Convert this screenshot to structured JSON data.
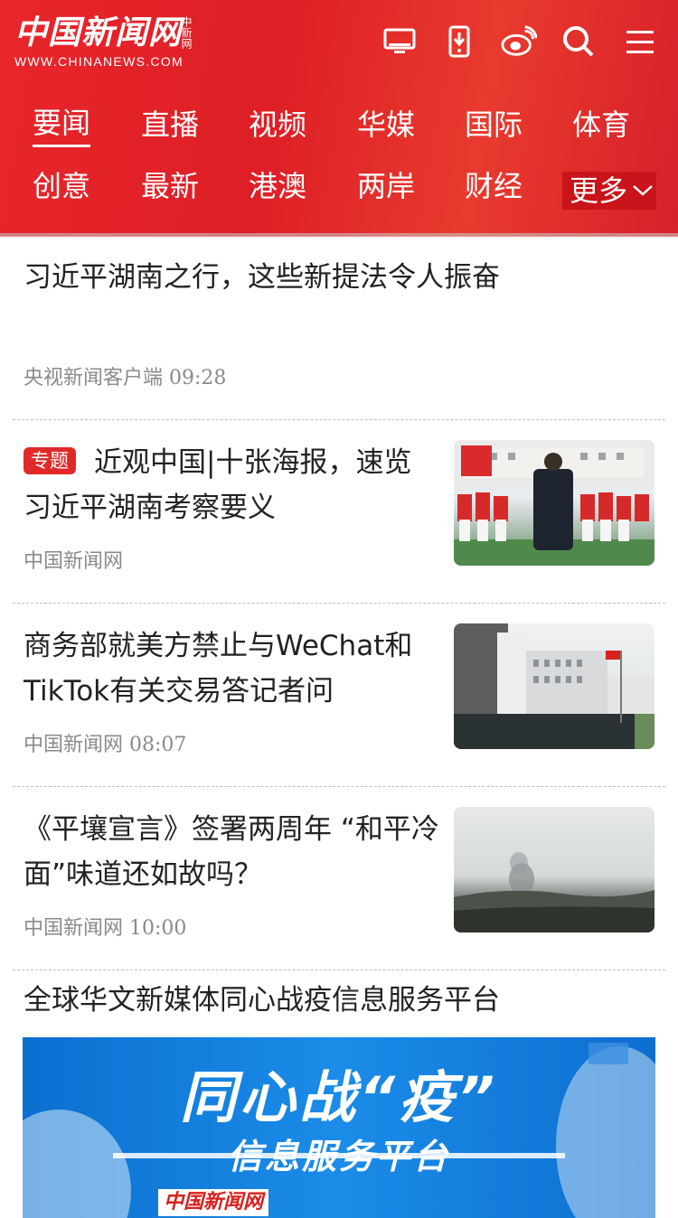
{
  "header": {
    "logo_cn": "中国新闻网",
    "logo_small": "中新网",
    "logo_en": "WWW.CHINANEWS.COM",
    "icons": [
      "tv-icon",
      "mobile-download-icon",
      "weibo-icon",
      "search-icon",
      "menu-icon"
    ]
  },
  "nav": {
    "row1": [
      "要闻",
      "直播",
      "视频",
      "华媒",
      "国际",
      "体育"
    ],
    "row2": [
      "创意",
      "最新",
      "港澳",
      "两岸",
      "财经"
    ],
    "more": "更多",
    "active": "要闻"
  },
  "articles": [
    {
      "title": "习近平湖南之行，这些新提法令人振奋",
      "source": "央视新闻客户端",
      "time": "09:28"
    },
    {
      "tag": "专题",
      "title": "近观中国|十张海报，速览习近平湖南考察要义",
      "source": "中国新闻网",
      "time": ""
    },
    {
      "title": "商务部就美方禁止与WeChat和TikTok有关交易答记者问",
      "source": "中国新闻网",
      "time": "08:07"
    },
    {
      "title": "《平壤宣言》签署两周年 “和平冷面”味道还如故吗？",
      "source": "中国新闻网",
      "time": "10:00"
    }
  ],
  "section": {
    "title": "全球华文新媒体同心战疫信息服务平台",
    "banner_line1": "同心战“疫”",
    "banner_line2": "信息服务平台",
    "banner_footer": "中国新闻网"
  },
  "colors": {
    "brand_red": "#e8262b",
    "tag_red": "#e02a2a",
    "banner_blue": "#1b8ce8"
  }
}
